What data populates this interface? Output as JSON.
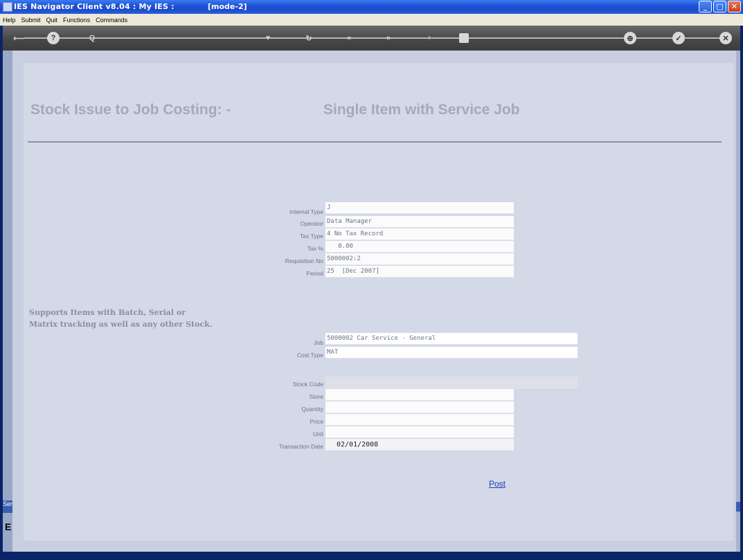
{
  "window": {
    "title": "IES Navigator Client v8.04 : My IES :",
    "mode": "[mode-2]"
  },
  "menu": [
    "Help",
    "Submit",
    "Quit",
    "Functions",
    "Commands"
  ],
  "toolbar": {
    "icons": [
      "back-arrow-icon",
      "help-icon",
      "search-icon",
      "heart-icon",
      "refresh-icon",
      "prev-icon",
      "next-icon",
      "sort-icon",
      "stop-icon",
      "print-icon",
      "confirm-icon",
      "close-icon"
    ],
    "glyphs": [
      "?",
      "Q",
      "♥",
      "↻",
      "«",
      "»",
      "↑",
      "■",
      "⊕",
      "✓",
      "✕"
    ]
  },
  "header": {
    "title_left": "Stock Issue to Job Costing: -",
    "title_right": "Single Item with Service Job"
  },
  "note": "Supports Items with Batch, Serial or Matrix tracking as well as any other Stock.",
  "form1": [
    {
      "label": "Internal Type",
      "value": "J"
    },
    {
      "label": "Operator",
      "value": "Data Manager"
    },
    {
      "label": "Tax Type",
      "value": "4 No Tax Record"
    },
    {
      "label": "Tax %",
      "value": "   0.00"
    },
    {
      "label": "Requisition No",
      "value": "5000002:2"
    },
    {
      "label": "Period",
      "value": "25  [Dec 2007]"
    }
  ],
  "form2": [
    {
      "label": "Job",
      "value": "5000002 Car Service - General"
    },
    {
      "label": "Cost Type",
      "value": "MAT"
    }
  ],
  "form3": [
    {
      "label": "Stock Code",
      "value": ""
    },
    {
      "label": "Store",
      "value": ""
    },
    {
      "label": "Quantity",
      "value": ""
    },
    {
      "label": "Price",
      "value": ""
    },
    {
      "label": "Unit",
      "value": ""
    },
    {
      "label": "Transaction Date",
      "value": "02/01/2008"
    }
  ],
  "post_label": "Post",
  "left_strip_label": "Ser",
  "left_strip_glyph": "E"
}
